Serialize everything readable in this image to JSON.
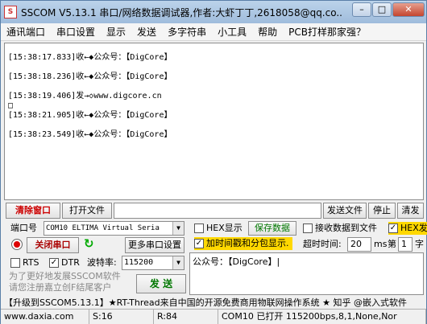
{
  "window": {
    "title": "SSCOM V5.13.1 串口/网络数据调试器,作者:大虾丁丁,2618058@qq.co...",
    "icon_text": "S"
  },
  "menu": [
    "通讯端口",
    "串口设置",
    "显示",
    "发送",
    "多字符串",
    "小工具",
    "帮助",
    "PCB打样那家强？"
  ],
  "log": [
    "[15:38:17.833]收←◆公众号：【DigCore】",
    "[15:38:18.236]收←◆公众号：【DigCore】",
    "[15:38:19.406]发→◇www.digcore.cn",
    "□",
    "[15:38:21.905]收←◆公众号：【DigCore】",
    "[15:38:23.549]收←◆公众号：【DigCore】"
  ],
  "toolbar": {
    "clear_window": "清除窗口",
    "open_file": "打开文件",
    "send_file": "发送文件",
    "stop": "停止",
    "clear_send": "清发"
  },
  "port": {
    "label": "端口号",
    "value": "COM10 ELTIMA Virtual Seria",
    "close_port": "关闭串口",
    "more_settings": "更多串口设置",
    "rts": "RTS",
    "dtr": "DTR",
    "baud_label": "波特率:",
    "baud_value": "115200"
  },
  "options": {
    "hex_display": "HEX显示",
    "save_data": "保存数据",
    "recv_to_file": "接收数据到文件",
    "hex_send": "HEX发",
    "timestamp": "加时间戳和分包显示.",
    "timeout_label": "超时时间:",
    "timeout_value": "20",
    "timeout_unit": "ms",
    "nth_label": "第",
    "nth_value": "1",
    "byte_label": "字"
  },
  "send": {
    "text": "公众号：【DigCore】|",
    "send_button": "发 送"
  },
  "promo": "为了更好地发展SSCOM软件\n请您注册嘉立创F结尾客户",
  "ticker": "【升级到SSCOM5.13.1】★RT-Thread来自中国的开源免费商用物联网操作系统 ★ 知乎 @嵌入式软件",
  "statusbar": [
    "www.daxia.com",
    "S:16",
    "R:84",
    "COM10 已打开  115200bps,8,1,None,Nor"
  ]
}
